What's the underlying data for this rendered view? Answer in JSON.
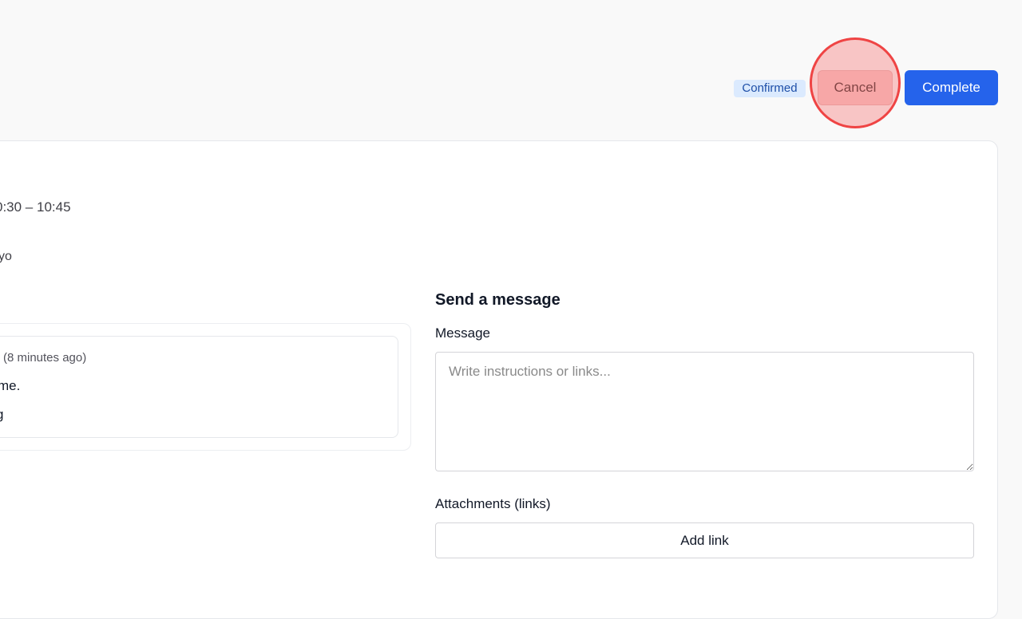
{
  "header": {
    "status_badge": "Confirmed",
    "cancel_label": "Cancel",
    "complete_label": "Complete"
  },
  "booking": {
    "time_range": "0:30 – 10:45",
    "host_fragment": "yo"
  },
  "history": {
    "items": [
      {
        "time_ago": "(8 minutes ago)",
        "line1": "me.",
        "line2": "g"
      }
    ]
  },
  "send_message": {
    "title": "Send a message",
    "message_label": "Message",
    "message_placeholder": "Write instructions or links...",
    "message_value": "",
    "attachments_label": "Attachments (links)",
    "add_link_label": "Add link"
  },
  "colors": {
    "primary": "#2563eb",
    "badge_bg": "#dbeafe",
    "badge_text": "#1e4fa8",
    "click_indicator": "#ef4444"
  }
}
